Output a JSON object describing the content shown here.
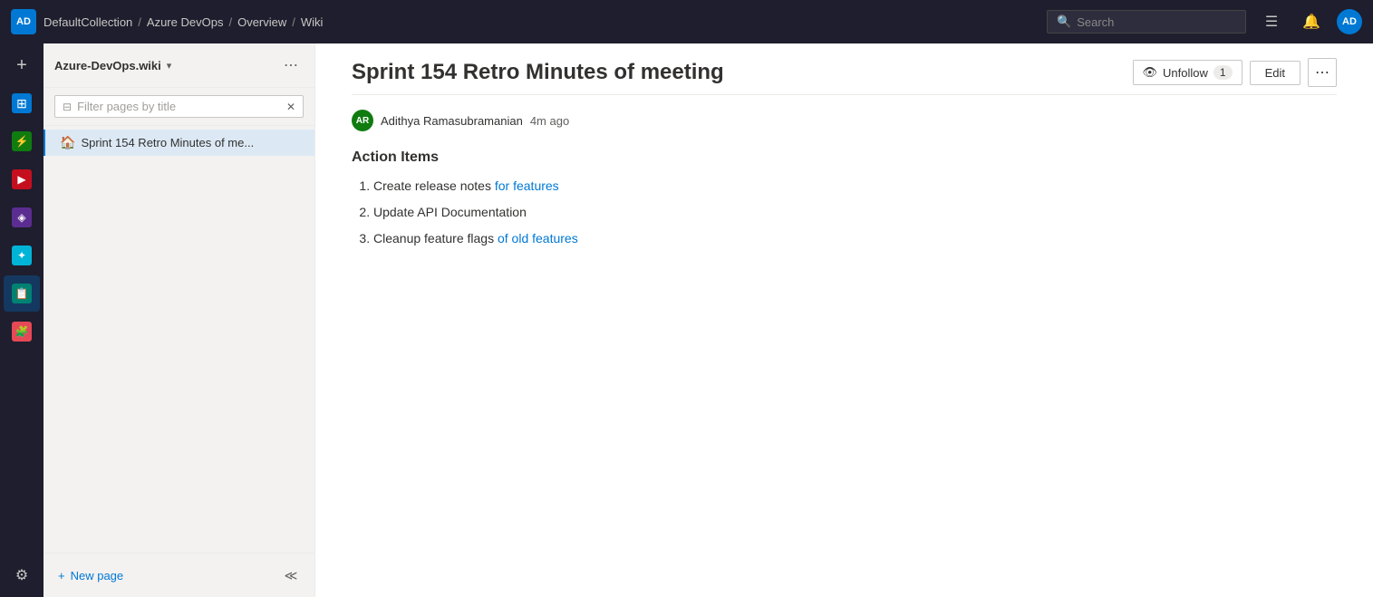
{
  "topNav": {
    "logo": "AD",
    "breadcrumbs": [
      {
        "label": "DefaultCollection"
      },
      {
        "label": "Azure DevOps"
      },
      {
        "label": "Overview"
      },
      {
        "label": "Wiki"
      }
    ],
    "search": {
      "placeholder": "Search"
    },
    "avatar": "AD"
  },
  "iconNav": {
    "items": [
      {
        "name": "add",
        "icon": "+",
        "tooltip": "Create"
      },
      {
        "name": "boards",
        "icon": "⊞",
        "tooltip": "Boards",
        "color": "blue"
      },
      {
        "name": "repos",
        "icon": "⚡",
        "tooltip": "Repos",
        "color": "green"
      },
      {
        "name": "pipelines",
        "icon": "▶",
        "tooltip": "Pipelines",
        "color": "red-dark"
      },
      {
        "name": "artifacts",
        "icon": "◈",
        "tooltip": "Artifacts",
        "color": "purple"
      },
      {
        "name": "testplans",
        "icon": "✓",
        "tooltip": "Test Plans",
        "color": "blue-light"
      },
      {
        "name": "wiki",
        "icon": "📋",
        "tooltip": "Wiki",
        "color": "teal"
      },
      {
        "name": "extension",
        "icon": "🧩",
        "tooltip": "Extensions",
        "color": "pink"
      }
    ],
    "bottom": {
      "settings": "⚙"
    }
  },
  "sidebar": {
    "wiki_name": "Azure-DevOps.wiki",
    "filter_placeholder": "Filter pages by title",
    "pages": [
      {
        "label": "Sprint 154 Retro Minutes of me...",
        "active": true
      }
    ],
    "new_page_label": "New page"
  },
  "content": {
    "page_title": "Sprint 154 Retro Minutes of meeting",
    "author": {
      "initials": "AR",
      "name": "Adithya Ramasubramanian",
      "time": "4m ago"
    },
    "unfollow_label": "Unfollow",
    "follower_count": "1",
    "edit_label": "Edit",
    "section_title": "Action Items",
    "items": [
      {
        "text_parts": [
          {
            "text": "Create release notes ",
            "type": "normal"
          },
          {
            "text": "for features",
            "type": "link"
          }
        ],
        "full": "Create release notes for features"
      },
      {
        "text_parts": [
          {
            "text": "Update API Documentation",
            "type": "normal"
          }
        ],
        "full": "Update API Documentation"
      },
      {
        "text_parts": [
          {
            "text": "Cleanup feature flags ",
            "type": "normal"
          },
          {
            "text": "of old features",
            "type": "link"
          }
        ],
        "full": "Cleanup feature flags of old features"
      }
    ]
  }
}
